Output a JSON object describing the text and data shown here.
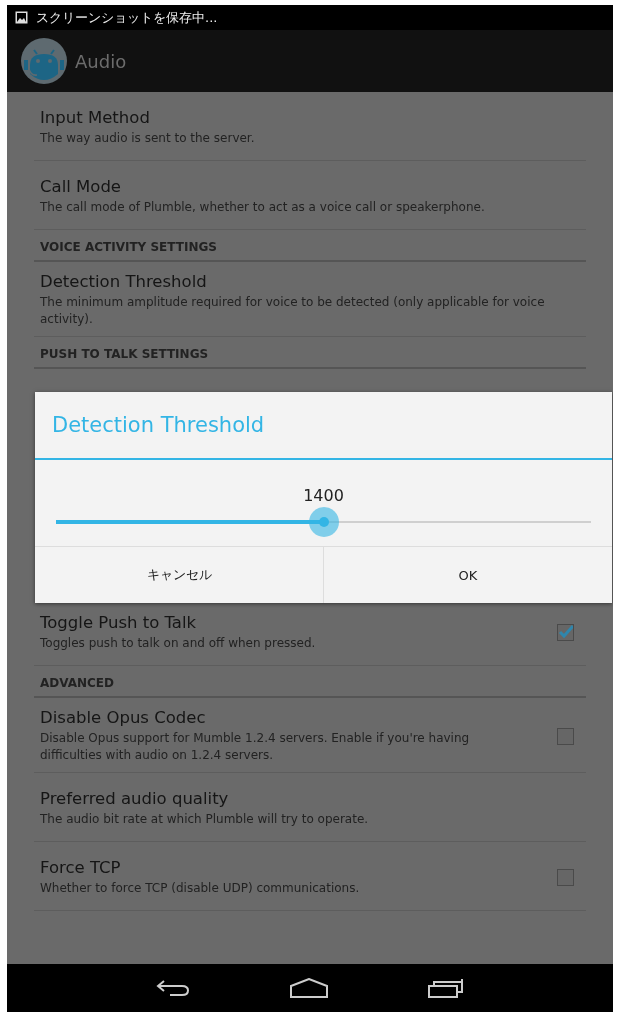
{
  "status_bar": {
    "text": "スクリーンショットを保存中..."
  },
  "action_bar": {
    "title": "Audio"
  },
  "items_above_dialog": [
    {
      "kind": "item",
      "title": "Input Method",
      "summary": "The way audio is sent to the server."
    },
    {
      "kind": "item",
      "title": "Call Mode",
      "summary": "The call mode of Plumble, whether to act as a voice call or speakerphone."
    },
    {
      "kind": "header",
      "title": "VOICE ACTIVITY SETTINGS"
    },
    {
      "kind": "item",
      "title": "Detection Threshold",
      "summary": "The minimum amplitude required for voice to be detected (only applicable for voice activity)."
    },
    {
      "kind": "header",
      "title": "PUSH TO TALK SETTINGS"
    }
  ],
  "items_below_dialog": [
    {
      "kind": "checkbox",
      "title": "Toggle Push to Talk",
      "summary": "Toggles push to talk on and off when pressed.",
      "checked": true
    },
    {
      "kind": "header",
      "title": "ADVANCED"
    },
    {
      "kind": "checkbox",
      "title": "Disable Opus Codec",
      "summary": "Disable Opus support for Mumble 1.2.4 servers. Enable if you're having difficulties with audio on 1.2.4 servers.",
      "checked": false
    },
    {
      "kind": "item",
      "title": "Preferred audio quality",
      "summary": "The audio bit rate at which Plumble will try to operate."
    },
    {
      "kind": "checkbox",
      "title": "Force TCP",
      "summary": "Whether to force TCP (disable UDP) communications.",
      "checked": false
    }
  ],
  "dialog": {
    "title": "Detection Threshold",
    "value": "1400",
    "level": 0.5,
    "buttons": [
      "キャンセル",
      "OK"
    ]
  }
}
